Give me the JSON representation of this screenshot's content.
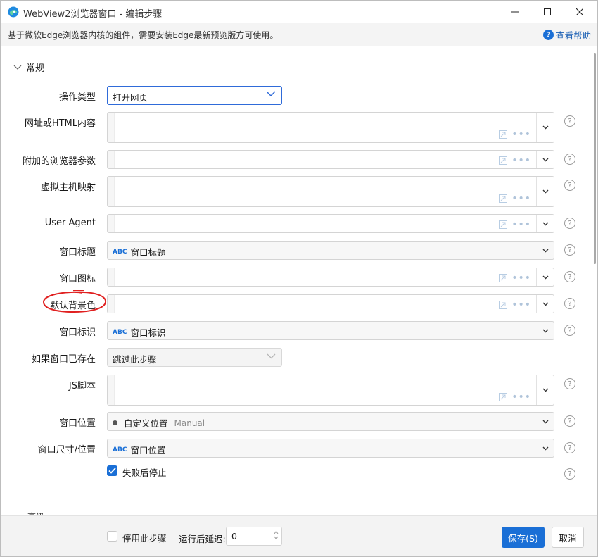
{
  "window": {
    "title": "WebView2浏览器窗口  -  编辑步骤"
  },
  "info": {
    "text": "基于微软Edge浏览器内核的组件，需要安装Edge最新预览版方可使用。",
    "help_label": "查看帮助"
  },
  "section": {
    "title": "常规",
    "collapsed_title": "高级"
  },
  "fields": {
    "op_type": {
      "label": "操作类型",
      "value": "打开网页"
    },
    "url": {
      "label": "网址或HTML内容"
    },
    "browser_args": {
      "label": "附加的浏览器参数"
    },
    "host_map": {
      "label": "虚拟主机映射"
    },
    "user_agent": {
      "label": "User Agent"
    },
    "win_title": {
      "label": "窗口标题",
      "prefix": "ABC",
      "value": "窗口标题"
    },
    "win_icon": {
      "label": "窗口图标"
    },
    "bg_color": {
      "label": "默认背景色"
    },
    "win_id": {
      "label": "窗口标识",
      "prefix": "ABC",
      "value": "窗口标识"
    },
    "if_exists": {
      "label": "如果窗口已存在",
      "value": "跳过此步骤"
    },
    "js": {
      "label": "JS脚本"
    },
    "win_pos": {
      "label": "窗口位置",
      "value": "自定义位置",
      "hint": "Manual"
    },
    "win_size": {
      "label": "窗口尺寸/位置",
      "prefix": "ABC",
      "value": "窗口位置"
    },
    "stop_on_fail": {
      "label": "失败后停止",
      "checked": true
    }
  },
  "footer": {
    "disable_label": "停用此步骤",
    "delay_label": "运行后延迟:",
    "delay_value": "0",
    "save_label": "保存(S)",
    "cancel_label": "取消"
  },
  "colors": {
    "accent": "#1a6fd6",
    "annotation": "#e02020"
  },
  "icons": [
    "edge-logo-icon",
    "minimize-icon",
    "maximize-icon",
    "close-icon",
    "help-circle-icon",
    "chevron-down-icon",
    "expand-editor-icon",
    "more-dots-icon",
    "checkmark-icon"
  ]
}
